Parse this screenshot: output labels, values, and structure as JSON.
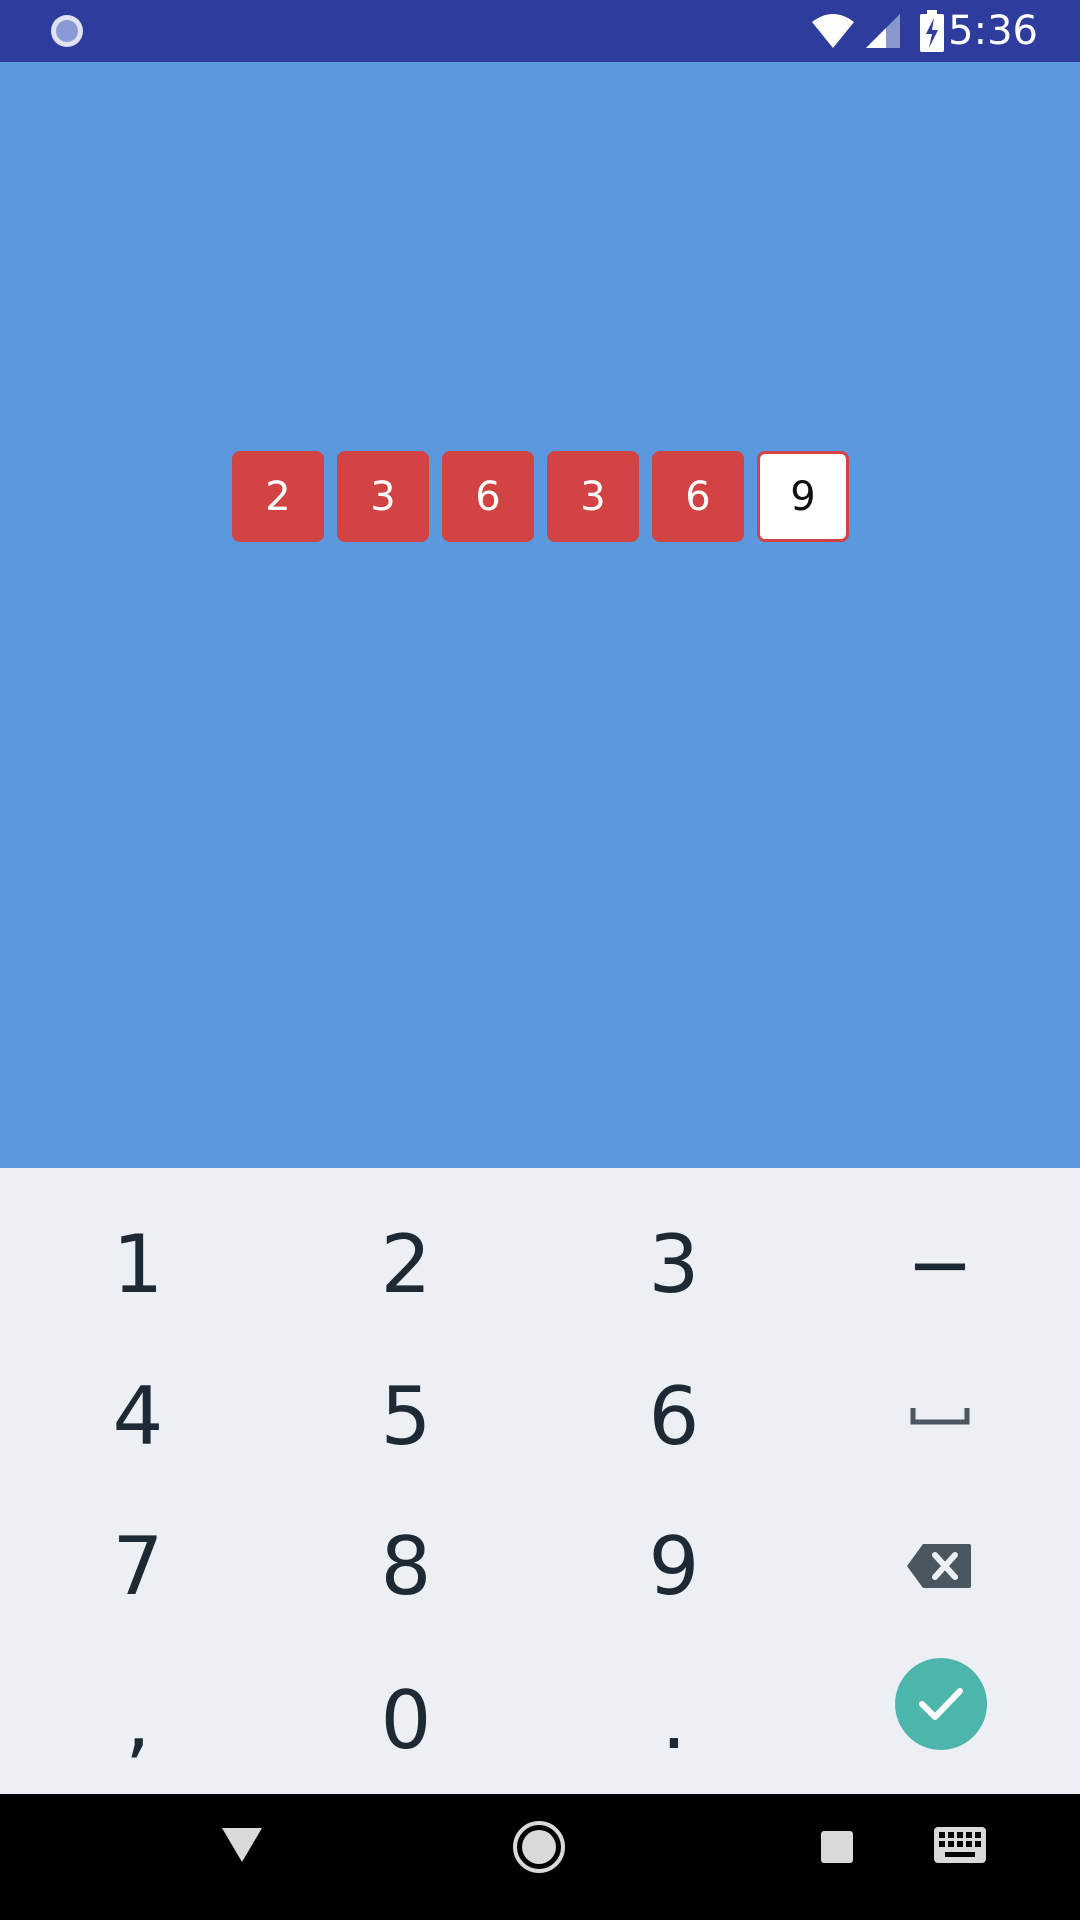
{
  "status_bar": {
    "time": "5:36",
    "icons": [
      "loading-circle-icon",
      "wifi-icon",
      "signal-icon",
      "battery-charging-icon"
    ],
    "color": "#2e3c9e"
  },
  "background_color": "#5c98dd",
  "otp": {
    "digits": [
      "2",
      "3",
      "6",
      "3",
      "6",
      "9"
    ],
    "filled_color": "#d24343",
    "active_index": 5
  },
  "keypad": {
    "rows": [
      [
        "1",
        "2",
        "3",
        "−"
      ],
      [
        "4",
        "5",
        "6",
        "space"
      ],
      [
        "7",
        "8",
        "9",
        "backspace"
      ],
      [
        ",",
        "0",
        ".",
        "done"
      ]
    ],
    "labels": {
      "k1": "1",
      "k2": "2",
      "k3": "3",
      "minus": "−",
      "k4": "4",
      "k5": "5",
      "k6": "6",
      "k7": "7",
      "k8": "8",
      "k9": "9",
      "comma": ",",
      "k0": "0",
      "period": "."
    },
    "special_icons": [
      "space-icon",
      "backspace-icon",
      "checkmark-icon"
    ],
    "done_color": "#4db6ac"
  },
  "nav_bar": {
    "icons": [
      "back-icon",
      "home-icon",
      "recents-icon",
      "keyboard-icon"
    ]
  }
}
